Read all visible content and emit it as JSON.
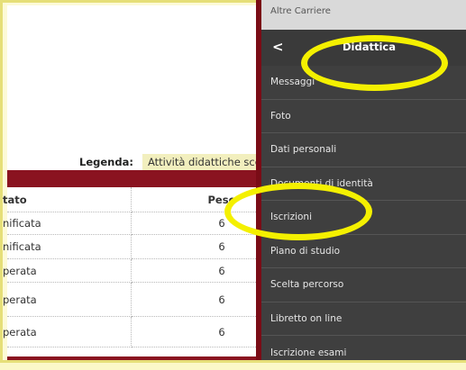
{
  "legend": {
    "label": "Legenda:",
    "item": "Attività didattiche scel"
  },
  "table": {
    "headers": [
      "tato",
      "Peso"
    ],
    "rows": [
      {
        "status": "nificata",
        "weight": "6"
      },
      {
        "status": "nificata",
        "weight": "6"
      },
      {
        "status": "perata",
        "weight": "6"
      },
      {
        "status": "perata",
        "weight": "6"
      },
      {
        "status": "perata",
        "weight": "6"
      }
    ]
  },
  "menu": {
    "top_item": "Altre Carriere",
    "back_icon": "chevron-left-icon",
    "back_glyph": "<",
    "title": "Didattica",
    "items": [
      {
        "label": "Messaggi"
      },
      {
        "label": "Foto"
      },
      {
        "label": "Dati personali"
      },
      {
        "label": "Documenti di identità"
      },
      {
        "label": "Iscrizioni"
      },
      {
        "label": "Piano di studio"
      },
      {
        "label": "Scelta percorso"
      },
      {
        "label": "Libretto on line"
      },
      {
        "label": "Iscrizione esami"
      }
    ]
  },
  "colors": {
    "accent_red": "#8a1320",
    "menu_bg": "#3f3f3f",
    "annotation": "#f4f000",
    "legend_swatch": "#f2efbe"
  }
}
